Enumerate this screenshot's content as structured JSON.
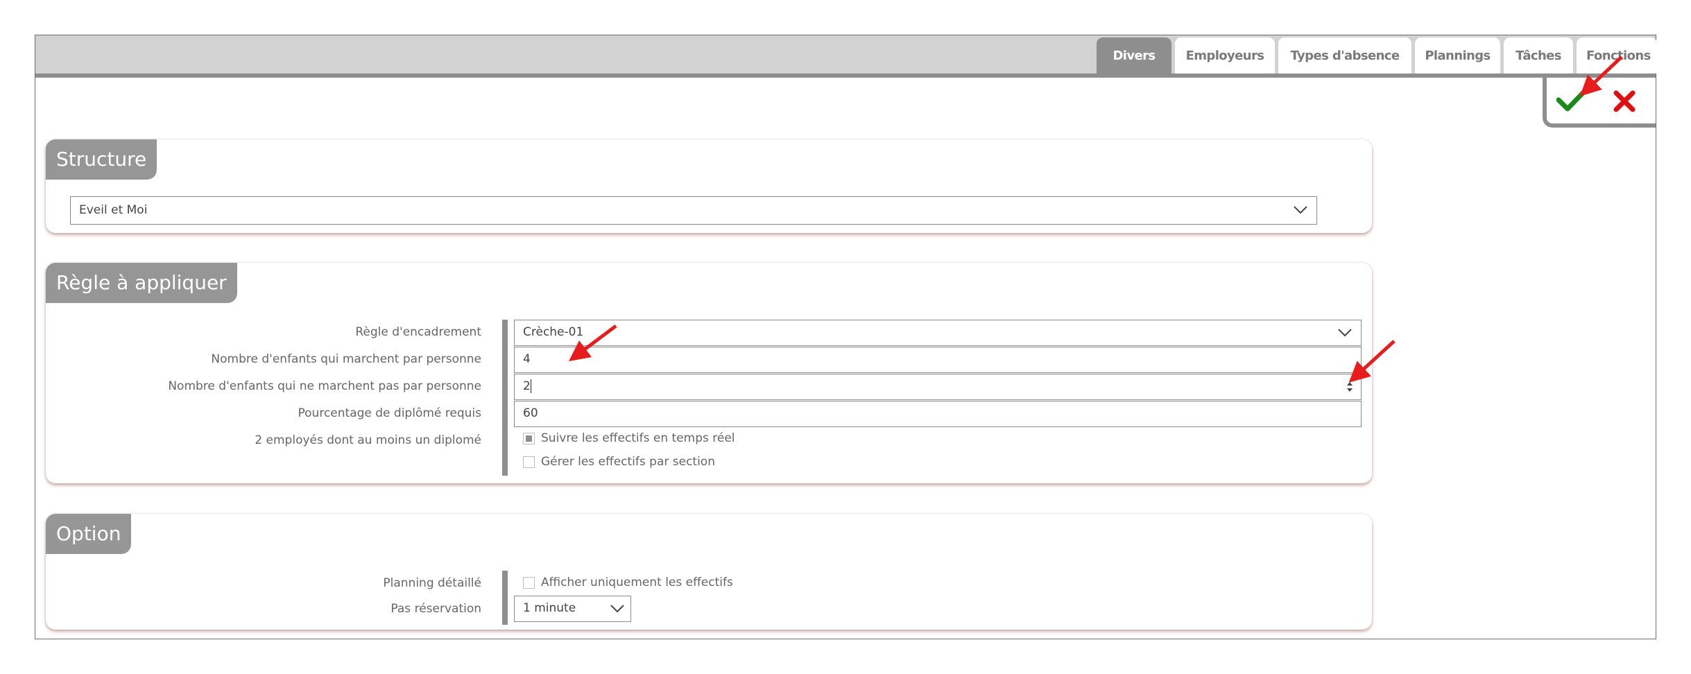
{
  "tabs": [
    {
      "label": "Divers",
      "active": true
    },
    {
      "label": "Employeurs"
    },
    {
      "label": "Types d'absence"
    },
    {
      "label": "Plannings"
    },
    {
      "label": "Tâches"
    },
    {
      "label": "Fonctions"
    }
  ],
  "actions": {
    "confirm_icon": "check-icon",
    "cancel_icon": "close-icon",
    "confirm_color": "#1a8a1a",
    "cancel_color": "#e01010"
  },
  "structure": {
    "title": "Structure",
    "selected": "Eveil et Moi"
  },
  "regle": {
    "title": "Règle à appliquer",
    "encadrement": {
      "label": "Règle d'encadrement",
      "value": "Crèche-01"
    },
    "marchent": {
      "label": "Nombre d'enfants qui marchent par personne",
      "value": "4"
    },
    "ne_marchent_pas": {
      "label": "Nombre d'enfants qui ne marchent pas par personne",
      "value": "2"
    },
    "pourcentage": {
      "label": "Pourcentage de diplômé requis",
      "value": "60"
    },
    "employes": {
      "label": "2 employés dont au moins un diplomé"
    },
    "suivre": {
      "label": "Suivre les effectifs en temps réel",
      "checked": true
    },
    "gerer": {
      "label": "Gérer les effectifs par section",
      "checked": false
    }
  },
  "option": {
    "title": "Option",
    "planning": {
      "label": "Planning détaillé"
    },
    "afficher": {
      "label": "Afficher uniquement les effectifs",
      "checked": false
    },
    "reservation": {
      "label": "Pas réservation",
      "value": "1 minute"
    }
  },
  "annotation_color": "#e81c1c"
}
